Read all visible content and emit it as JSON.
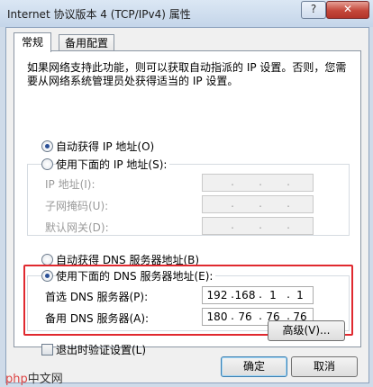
{
  "window": {
    "title": "Internet 协议版本 4 (TCP/IPv4) 属性",
    "help_glyph": "?",
    "close_glyph": "✕"
  },
  "tabs": [
    "常规",
    "备用配置"
  ],
  "description": "如果网络支持此功能，则可以获取自动指派的 IP 设置。否则，您需要从网络系统管理员处获得适当的 IP 设置。",
  "ip_section": {
    "auto_label": "自动获得 IP 地址(O)",
    "manual_label": "使用下面的 IP 地址(S):",
    "selected": "auto",
    "fields": [
      {
        "label": "IP 地址(I):",
        "octets": [
          "",
          "",
          "",
          ""
        ]
      },
      {
        "label": "子网掩码(U):",
        "octets": [
          "",
          "",
          "",
          ""
        ]
      },
      {
        "label": "默认网关(D):",
        "octets": [
          "",
          "",
          "",
          ""
        ]
      }
    ]
  },
  "dns_section": {
    "auto_label": "自动获得 DNS 服务器地址(B)",
    "manual_label": "使用下面的 DNS 服务器地址(E):",
    "selected": "manual",
    "preferred": {
      "label": "首选 DNS 服务器(P):",
      "octets": [
        "192",
        "168",
        "1",
        "1"
      ]
    },
    "alternate": {
      "label": "备用 DNS 服务器(A):",
      "octets": [
        "180",
        "76",
        "76",
        "76"
      ]
    }
  },
  "validate_on_exit": {
    "label": "退出时验证设置(L)",
    "checked": false
  },
  "advanced_button": "高级(V)...",
  "ok_button": "确定",
  "cancel_button": "取消",
  "watermark": {
    "brand": "php",
    "suffix": "中文网"
  },
  "colors": {
    "highlight": "#e0292f",
    "title_bar": "#c4d5e9",
    "dialog_bg": "#f0f0f0"
  }
}
